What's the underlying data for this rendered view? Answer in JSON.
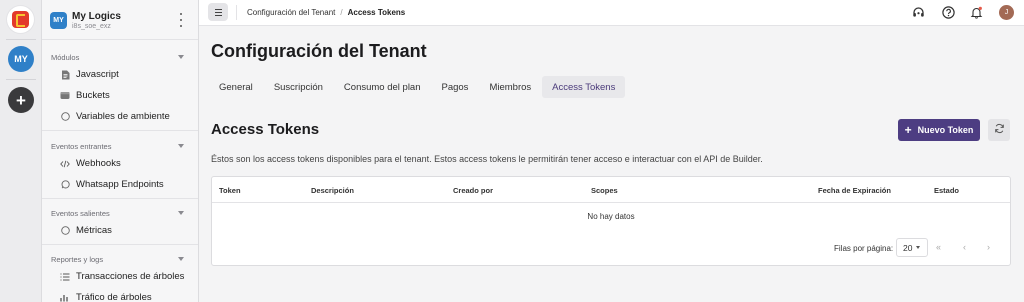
{
  "rail": {
    "workspace_initials": "MY",
    "add_label": "+"
  },
  "workspace": {
    "initials": "MY",
    "name": "My Logics",
    "id": "i8s_soe_exz"
  },
  "sidebar": {
    "sections": [
      {
        "title": "Módulos",
        "items": [
          {
            "label": "Javascript",
            "icon": "file-icon"
          },
          {
            "label": "Buckets",
            "icon": "bucket-icon"
          },
          {
            "label": "Variables de ambiente",
            "icon": "circle-icon"
          }
        ]
      },
      {
        "title": "Eventos entrantes",
        "items": [
          {
            "label": "Webhooks",
            "icon": "code-icon"
          },
          {
            "label": "Whatsapp Endpoints",
            "icon": "whatsapp-icon"
          }
        ]
      },
      {
        "title": "Eventos salientes",
        "items": [
          {
            "label": "Métricas",
            "icon": "circle-icon"
          }
        ]
      },
      {
        "title": "Reportes y logs",
        "items": [
          {
            "label": "Transacciones de árboles",
            "icon": "list-icon"
          },
          {
            "label": "Tráfico de árboles",
            "icon": "chart-icon"
          }
        ]
      }
    ]
  },
  "breadcrumb": {
    "parent": "Configuración del Tenant",
    "separator": "/",
    "current": "Access Tokens"
  },
  "header": {
    "user_initial": "J"
  },
  "page": {
    "title": "Configuración del Tenant",
    "tabs": [
      {
        "label": "General"
      },
      {
        "label": "Suscripción"
      },
      {
        "label": "Consumo del plan"
      },
      {
        "label": "Pagos"
      },
      {
        "label": "Miembros"
      },
      {
        "label": "Access Tokens"
      }
    ],
    "active_tab": "Access Tokens",
    "section_title": "Access Tokens",
    "new_button": "Nuevo Token",
    "description": "Éstos son los access tokens disponibles para el tenant. Estos access tokens le permitirán tener acceso e interactuar con el API de Builder."
  },
  "table": {
    "columns": [
      "Token",
      "Descripción",
      "Creado por",
      "Scopes",
      "Fecha de Expiración",
      "Estado"
    ],
    "empty": "No hay datos",
    "rows_per_page_label": "Filas por página:",
    "rows_per_page": "20"
  },
  "colors": {
    "primary": "#4d3d82",
    "rail_avatar": "#2f80c8",
    "logo": "#e33a2c"
  }
}
